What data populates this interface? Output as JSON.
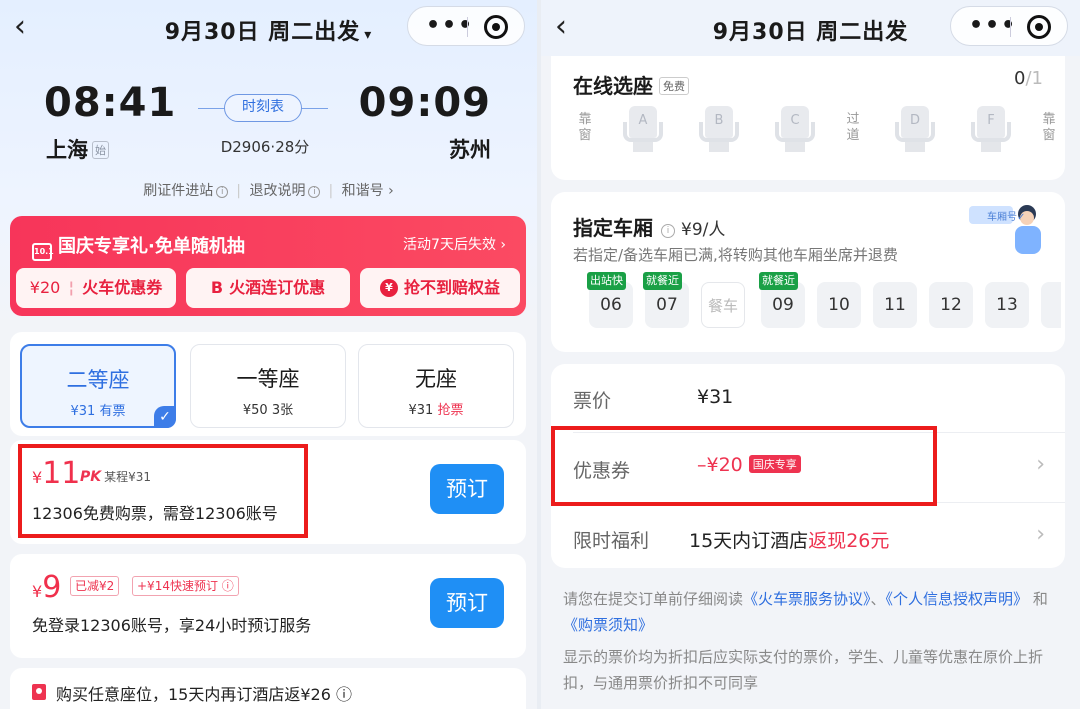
{
  "left": {
    "nav": {
      "back": "‹",
      "title": "9月30日 周二出发",
      "caret": "▾"
    },
    "trip": {
      "dep_time": "08:41",
      "dep_city": "上海",
      "dep_tag": "始",
      "arr_time": "09:09",
      "arr_city": "苏州",
      "schedule": "时刻表",
      "train": "D2906·28分"
    },
    "links": [
      "刷证件进站",
      "退改说明",
      "和谐号"
    ],
    "promo": {
      "title": "国庆专享礼·免单随机抽",
      "cal_text": "10.1",
      "right": "活动7天后失效 ›",
      "chips": [
        {
          "price": "¥20",
          "text": "火车优惠券"
        },
        {
          "icon": "B",
          "text": "火酒连订优惠"
        },
        {
          "icon": "¥",
          "text": "抢不到赔权益"
        }
      ]
    },
    "seats": [
      {
        "name": "二等座",
        "price": "¥31",
        "status": "有票"
      },
      {
        "name": "一等座",
        "price": "¥50",
        "status": "3张"
      },
      {
        "name": "无座",
        "price": "¥31",
        "status": "抢票"
      }
    ],
    "offer1": {
      "currency": "¥",
      "price": "11",
      "pk": "PK",
      "compare": "某程¥31",
      "desc": "12306免费购票，需登12306账号",
      "button": "预订"
    },
    "offer2": {
      "currency": "¥",
      "price": "9",
      "tag1": "已减¥2",
      "tag2": "+¥14快速预订 ⓘ",
      "desc": "免登录12306账号，享24小时预订服务",
      "button": "预订"
    },
    "hotel": "购买任意座位，15天内再订酒店返¥26 ⓘ"
  },
  "right": {
    "nav": {
      "back": "‹",
      "title": "9月30日 周二出发"
    },
    "seat_select": {
      "title": "在线选座",
      "free": "免费",
      "count": "0",
      "count_total": "/1",
      "left_label": "靠窗",
      "aisle_label": "过道",
      "right_label": "靠窗",
      "seats": [
        "A",
        "B",
        "C",
        "D",
        "F"
      ]
    },
    "carriage": {
      "title": "指定车厢",
      "price": "¥9/人",
      "note": "若指定/备选车厢已满,将转购其他车厢坐席并退费",
      "banner": "车厢号✓",
      "cars": [
        {
          "label": "06",
          "tag": "出站快"
        },
        {
          "label": "07",
          "tag": "就餐近"
        },
        {
          "label": "餐车",
          "tag": ""
        },
        {
          "label": "09",
          "tag": "就餐近"
        },
        {
          "label": "10",
          "tag": ""
        },
        {
          "label": "11",
          "tag": ""
        },
        {
          "label": "12",
          "tag": ""
        },
        {
          "label": "13",
          "tag": ""
        }
      ]
    },
    "pricing": {
      "ticket_label": "票价",
      "ticket_value": "¥31",
      "coupon_label": "优惠券",
      "coupon_value": "–¥20",
      "coupon_tag": "国庆专享",
      "benefit_label": "限时福利",
      "benefit_prefix": "15天内订酒店",
      "benefit_highlight": "返现26元"
    },
    "notice": {
      "p1_pre": "请您在提交订单前仔细阅读",
      "link1": "《火车票服务协议》",
      "sep": "、",
      "link2": "《个人信息授权声明》",
      "and": "和",
      "link3": "《购票须知》",
      "p2": "显示的票价均为折扣后应实际支付的票价，学生、儿童等优惠在原价上折扣，与通用票价折扣不可同享"
    }
  },
  "colors": {
    "brand_blue": "#1f8ff5",
    "accent_red": "#ee3350",
    "annotation_red": "#ec1c1c",
    "green_tag": "#1aa046"
  }
}
